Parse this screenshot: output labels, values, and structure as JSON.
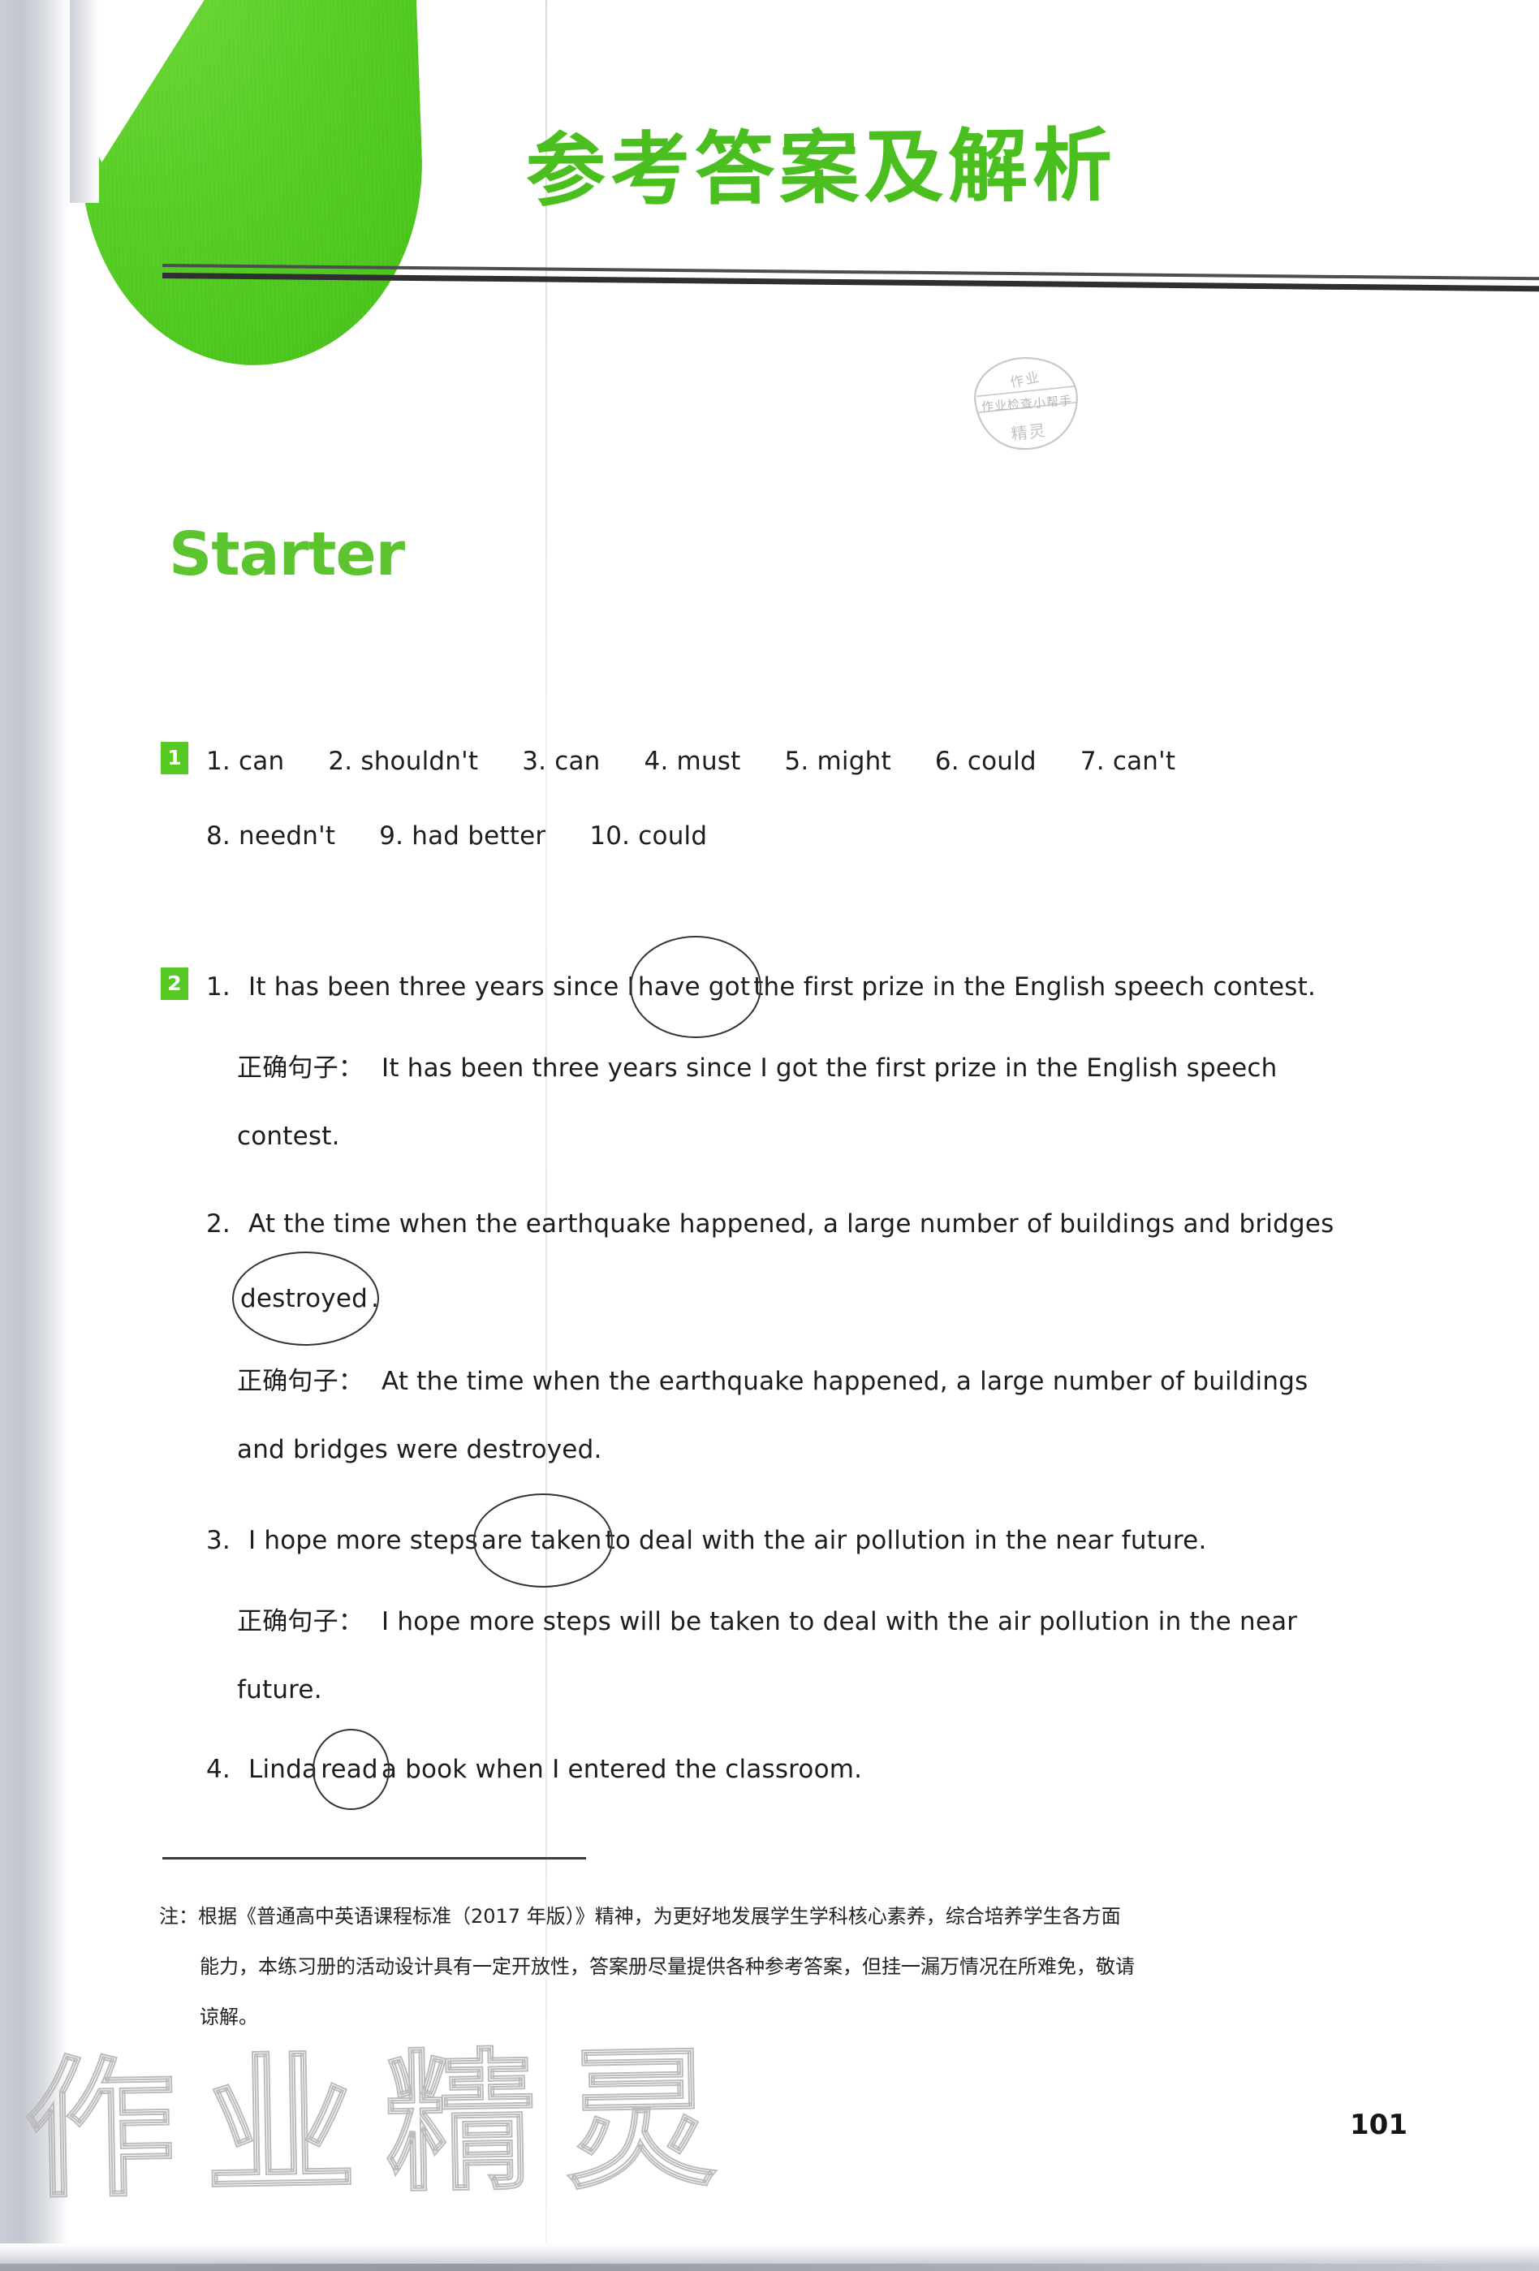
{
  "page": {
    "title": "参考答案及解析",
    "page_number": "101",
    "section_heading": "Starter"
  },
  "stamp_watermark": {
    "top_text": "作业",
    "middle_text": "作业检查小帮手",
    "bottom_text": "精灵"
  },
  "bottom_watermark": {
    "text": "作业精灵"
  },
  "exercises": [
    {
      "badge": "1",
      "lines": [
        {
          "items": [
            "1. can",
            "2. shouldn't",
            "3. can",
            "4. must",
            "5. might",
            "6. could",
            "7. can't"
          ]
        },
        {
          "items": [
            "8. needn't",
            "9. had better",
            "10. could"
          ]
        }
      ]
    },
    {
      "badge": "2",
      "items": [
        {
          "number": "1.",
          "sentence_pre": "It has been three years since I",
          "circled": "have got",
          "sentence_post": "the first prize in the English speech contest.",
          "correction_label": "正确句子：",
          "correction_line1": "It has been three years since I got the first prize in the English speech",
          "correction_line2": "contest."
        },
        {
          "number": "2.",
          "sentence_line1": "At the time when the earthquake happened, a large number of buildings and bridges",
          "circled": "destroyed",
          "sentence_post": ".",
          "correction_label": "正确句子：",
          "correction_line1": "At the time when the earthquake happened, a large number of buildings",
          "correction_line2": "and bridges were destroyed."
        },
        {
          "number": "3.",
          "sentence_pre": "I hope more steps",
          "circled": "are taken",
          "sentence_post": "to deal with the air pollution in the near future.",
          "correction_label": "正确句子：",
          "correction_line1": "I hope more steps will be taken to deal with the air pollution in the near",
          "correction_line2": "future."
        },
        {
          "number": "4.",
          "sentence_pre": "Linda",
          "circled": "read",
          "sentence_post": "a book when I entered the classroom."
        }
      ]
    }
  ],
  "footnote": {
    "label": "注：",
    "line1": "根据《普通高中英语课程标准（2017 年版）》精神，为更好地发展学生学科核心素养，综合培养学生各方面",
    "line2": "能力，本练习册的活动设计具有一定开放性，答案册尽量提供各种参考答案，但挂一漏万情况在所难免，敬请",
    "line3": "谅解。"
  },
  "colors": {
    "brand_green": "#4cbf20",
    "badge_green": "#56c924",
    "heading_green": "#5cc42e",
    "text_black": "#1d1d1d"
  }
}
